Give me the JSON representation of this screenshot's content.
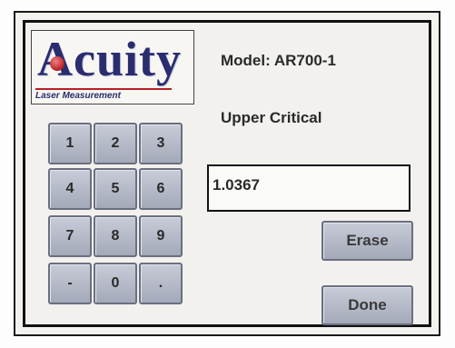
{
  "logo": {
    "word": "Acuity",
    "tagline": "Laser Measurement"
  },
  "model": {
    "text": "Model:  AR700-1"
  },
  "field": {
    "label": "Upper Critical",
    "value": "1.0367"
  },
  "keypad": {
    "keys": [
      "1",
      "2",
      "3",
      "4",
      "5",
      "6",
      "7",
      "8",
      "9",
      "-",
      "0",
      "."
    ]
  },
  "buttons": {
    "erase": "Erase",
    "done": "Done"
  },
  "colors": {
    "brand": "#2a2d6e",
    "accent": "#b52025",
    "key_face": "#b6bac9"
  }
}
